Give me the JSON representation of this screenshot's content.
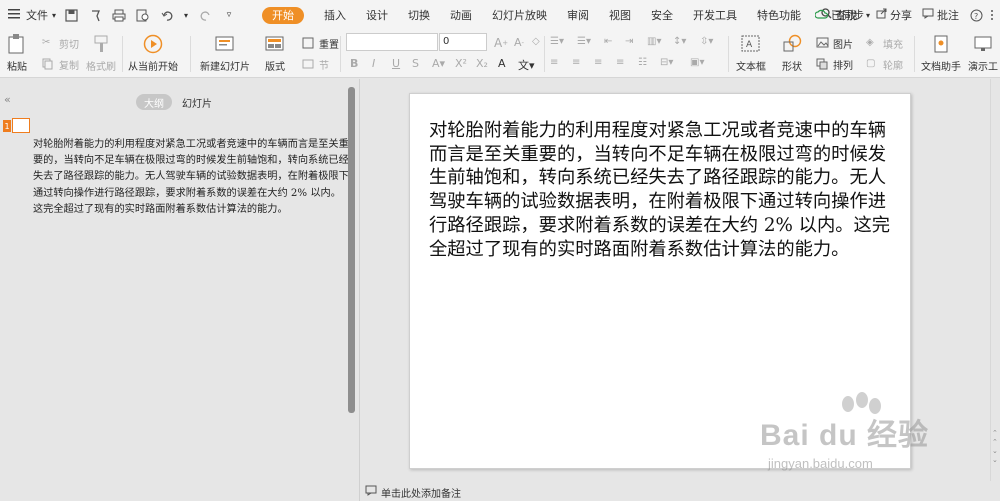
{
  "menubar": {
    "file_label": "文件",
    "tabs": [
      {
        "label": "开始",
        "active": true
      },
      {
        "label": "插入"
      },
      {
        "label": "设计"
      },
      {
        "label": "切换"
      },
      {
        "label": "动画"
      },
      {
        "label": "幻灯片放映"
      },
      {
        "label": "审阅"
      },
      {
        "label": "视图"
      },
      {
        "label": "安全"
      },
      {
        "label": "开发工具"
      },
      {
        "label": "特色功能"
      }
    ],
    "search_label": "查找",
    "sync_label": "已同步",
    "share_label": "分享",
    "comment_label": "批注"
  },
  "ribbon": {
    "paste": "粘贴",
    "cut": "剪切",
    "copy": "复制",
    "format_painter": "格式刷",
    "from_current": "从当前开始",
    "new_slide": "新建幻灯片",
    "layout": "版式",
    "reset": "重置",
    "section": "节",
    "font_size_value": "0",
    "textbox": "文本框",
    "shape": "形状",
    "picture": "图片",
    "fill": "填充",
    "arrange": "排列",
    "outline": "轮廓",
    "doc_assistant": "文档助手",
    "present_tool": "演示工"
  },
  "left_panel": {
    "tab_outline": "大纲",
    "tab_slides": "幻灯片",
    "slide_number": "1",
    "outline_text": "对轮胎附着能力的利用程度对紧急工况或者竞速中的车辆而言是至关重要的，当转向不足车辆在极限过弯的时候发生前轴饱和，转向系统已经失去了路径跟踪的能力。无人驾驶车辆的试验数据表明，在附着极限下通过转向操作进行路径跟踪，要求附着系数的误差在大约 2% 以内。这完全超过了现有的实时路面附着系数估计算法的能力。"
  },
  "slide": {
    "text": "对轮胎附着能力的利用程度对紧急工况或者竞速中的车辆而言是至关重要的，当转向不足车辆在极限过弯的时候发生前轴饱和，转向系统已经失去了路径跟踪的能力。无人驾驶车辆的试验数据表明，在附着极限下通过转向操作进行路径跟踪，要求附着系数的误差在大约 2% 以内。这完全超过了现有的实时路面附着系数估计算法的能力。"
  },
  "notes": {
    "placeholder": "单击此处添加备注"
  },
  "watermark": {
    "brand": "Bai du 经验",
    "url": "jingyan.baidu.com"
  },
  "colors": {
    "accent": "#ef8f26",
    "slide_bg": "#ffffff",
    "app_bg": "#e6e6e6"
  }
}
